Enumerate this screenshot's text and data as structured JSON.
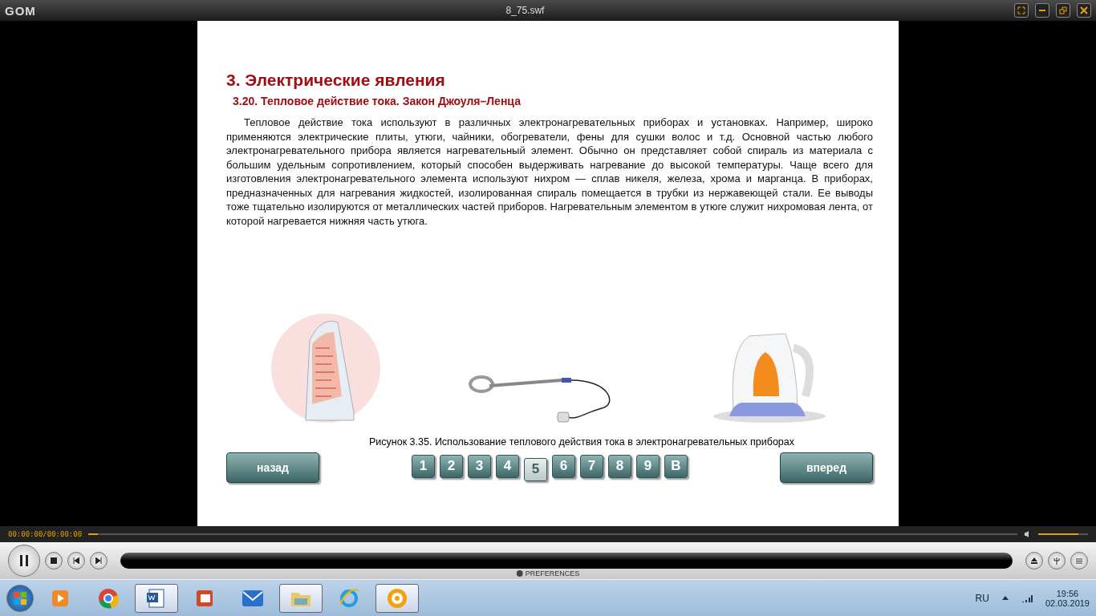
{
  "window": {
    "logo": "GOM",
    "title": "8_75.swf"
  },
  "slide": {
    "heading": "3. Электрические явления",
    "subheading": "3.20. Тепловое действие тока. Закон Джоуля–Ленца",
    "paragraph": "Тепловое действие тока используют в различных электронагревательных приборах и установках. Например, широко применяются электрические плиты, утюги, чайники, обогреватели, фены для сушки волос и т.д. Основной частью любого электронагревательного прибора является нагревательный элемент. Обычно он представляет собой спираль из материала с большим удельным сопротивлением, который способен выдерживать нагревание до высокой температуры. Чаще всего для изготовления электронагревательного элемента используют нихром — сплав никеля, железа, хрома и марганца. В приборах, предназначенных для нагревания жидкостей, изолированная спираль помещается в трубки из нержавеющей стали. Ее выводы тоже тщательно изолируются от металлических частей приборов. Нагревательным элементом в утюге служит нихромовая лента, от которой нагревается нижняя часть утюга.",
    "caption": "Рисунок 3.35. Использование теплового действия тока в электронагревательных приборах",
    "back": "назад",
    "forward": "вперед",
    "pages": [
      {
        "label": "1",
        "selected": false
      },
      {
        "label": "2",
        "selected": false
      },
      {
        "label": "3",
        "selected": false
      },
      {
        "label": "4",
        "selected": false
      },
      {
        "label": "5",
        "selected": true
      },
      {
        "label": "6",
        "selected": false
      },
      {
        "label": "7",
        "selected": false
      },
      {
        "label": "8",
        "selected": false
      },
      {
        "label": "9",
        "selected": false
      },
      {
        "label": "В",
        "selected": false
      }
    ]
  },
  "player": {
    "time": "00:00:00/00:00:00",
    "seek": {
      "level": 0.01
    },
    "volume": {
      "level": 0.8
    },
    "preferences": "PREFERENCES"
  },
  "taskbar": {
    "apps": [
      {
        "kind": "media",
        "open": false
      },
      {
        "kind": "chrome",
        "open": false
      },
      {
        "kind": "word",
        "open": true
      },
      {
        "kind": "slides",
        "open": false
      },
      {
        "kind": "mail",
        "open": false
      },
      {
        "kind": "folder",
        "open": true
      },
      {
        "kind": "ie",
        "open": false
      },
      {
        "kind": "gom",
        "open": true
      }
    ],
    "language": "RU",
    "time": "19:56",
    "date": "02.03.2019"
  }
}
